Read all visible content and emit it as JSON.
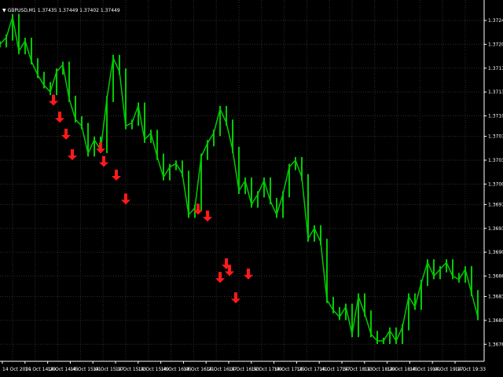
{
  "chart": {
    "symbol_timeframe": "GBPUSD,M1",
    "ohlc_readout": "1.37435 1.37449 1.37402 1.37449",
    "collapse_icon": "triangle-down-icon"
  },
  "chart_data": {
    "type": "line",
    "title": "GBPUSD,M1",
    "instrument": "GBPUSD",
    "timeframe": "M1",
    "ohlc": [
      "1.37435",
      "1.37449",
      "1.37402",
      "1.37449"
    ],
    "y_ticks": [
      "1.37240",
      "1.37205",
      "1.37170",
      "1.37135",
      "1.37100",
      "1.37070",
      "1.37035",
      "1.37000",
      "1.36970",
      "1.36935",
      "1.36900",
      "1.36865",
      "1.36835",
      "1.36800",
      "1.36765"
    ],
    "x_ticks": [
      "14 Oct 2021",
      "14 Oct 14:29",
      "14 Oct 14:45",
      "14 Oct 15:01",
      "14 Oct 15:17",
      "14 Oct 15:33",
      "14 Oct 15:49",
      "14 Oct 16:05",
      "14 Oct 16:21",
      "14 Oct 16:37",
      "14 Oct 16:53",
      "14 Oct 17:09",
      "14 Oct 17:25",
      "14 Oct 17:41",
      "14 Oct 17:57",
      "14 Oct 18:13",
      "14 Oct 18:29",
      "14 Oct 18:45",
      "14 Oct 19:01",
      "14 Oct 19:17",
      "14 Oct 19:33"
    ],
    "ylim": [
      1.3674,
      1.3727
    ],
    "grid": true,
    "series": [
      {
        "color": "#00cc00",
        "x_minutes": [
          0,
          4,
          8,
          12,
          16,
          20,
          24,
          28,
          32,
          36,
          40,
          44,
          48,
          52,
          56,
          60,
          64,
          68,
          72,
          76,
          80,
          84,
          88,
          92,
          96,
          100,
          104,
          108,
          112,
          116,
          120,
          124,
          128,
          132,
          136,
          140,
          144,
          148,
          152,
          156,
          160,
          164,
          168,
          172,
          176,
          180,
          184,
          188,
          192,
          196,
          200,
          204,
          208,
          212,
          216,
          220,
          224,
          228,
          232,
          236,
          240,
          244,
          248,
          252,
          256,
          260,
          264,
          268,
          272,
          276,
          280,
          284,
          288,
          292,
          296,
          300,
          304
        ],
        "values": [
          1.37205,
          1.37215,
          1.37245,
          1.37195,
          1.3721,
          1.3718,
          1.3716,
          1.37145,
          1.37135,
          1.37165,
          1.37175,
          1.37125,
          1.37095,
          1.37085,
          1.37045,
          1.37065,
          1.3705,
          1.37125,
          1.37185,
          1.37165,
          1.37085,
          1.3709,
          1.37115,
          1.37065,
          1.37075,
          1.3704,
          1.3701,
          1.37025,
          1.3703,
          1.37015,
          1.36955,
          1.36965,
          1.3704,
          1.3706,
          1.37075,
          1.3711,
          1.3709,
          1.3705,
          1.3699,
          1.37005,
          1.3697,
          1.36985,
          1.37005,
          1.36975,
          1.36955,
          1.36985,
          1.37025,
          1.37035,
          1.3701,
          1.3692,
          1.36935,
          1.36915,
          1.3683,
          1.36815,
          1.36805,
          1.3682,
          1.3678,
          1.36835,
          1.3681,
          1.3678,
          1.3677,
          1.3677,
          1.36785,
          1.3677,
          1.3679,
          1.36835,
          1.3682,
          1.36855,
          1.36885,
          1.36865,
          1.36875,
          1.36885,
          1.36865,
          1.3686,
          1.36875,
          1.3684,
          1.36805
        ]
      }
    ],
    "signals": {
      "type": "sell",
      "color": "#ff1a1a",
      "x_minutes": [
        34,
        38,
        42,
        46,
        64,
        66,
        74,
        80,
        126,
        132,
        140,
        144,
        146,
        150,
        158
      ],
      "y_values": [
        1.37115,
        1.3709,
        1.37065,
        1.37035,
        1.37045,
        1.37025,
        1.37005,
        1.3697,
        1.36955,
        1.36945,
        1.36855,
        1.36875,
        1.36865,
        1.36825,
        1.3686
      ]
    }
  }
}
